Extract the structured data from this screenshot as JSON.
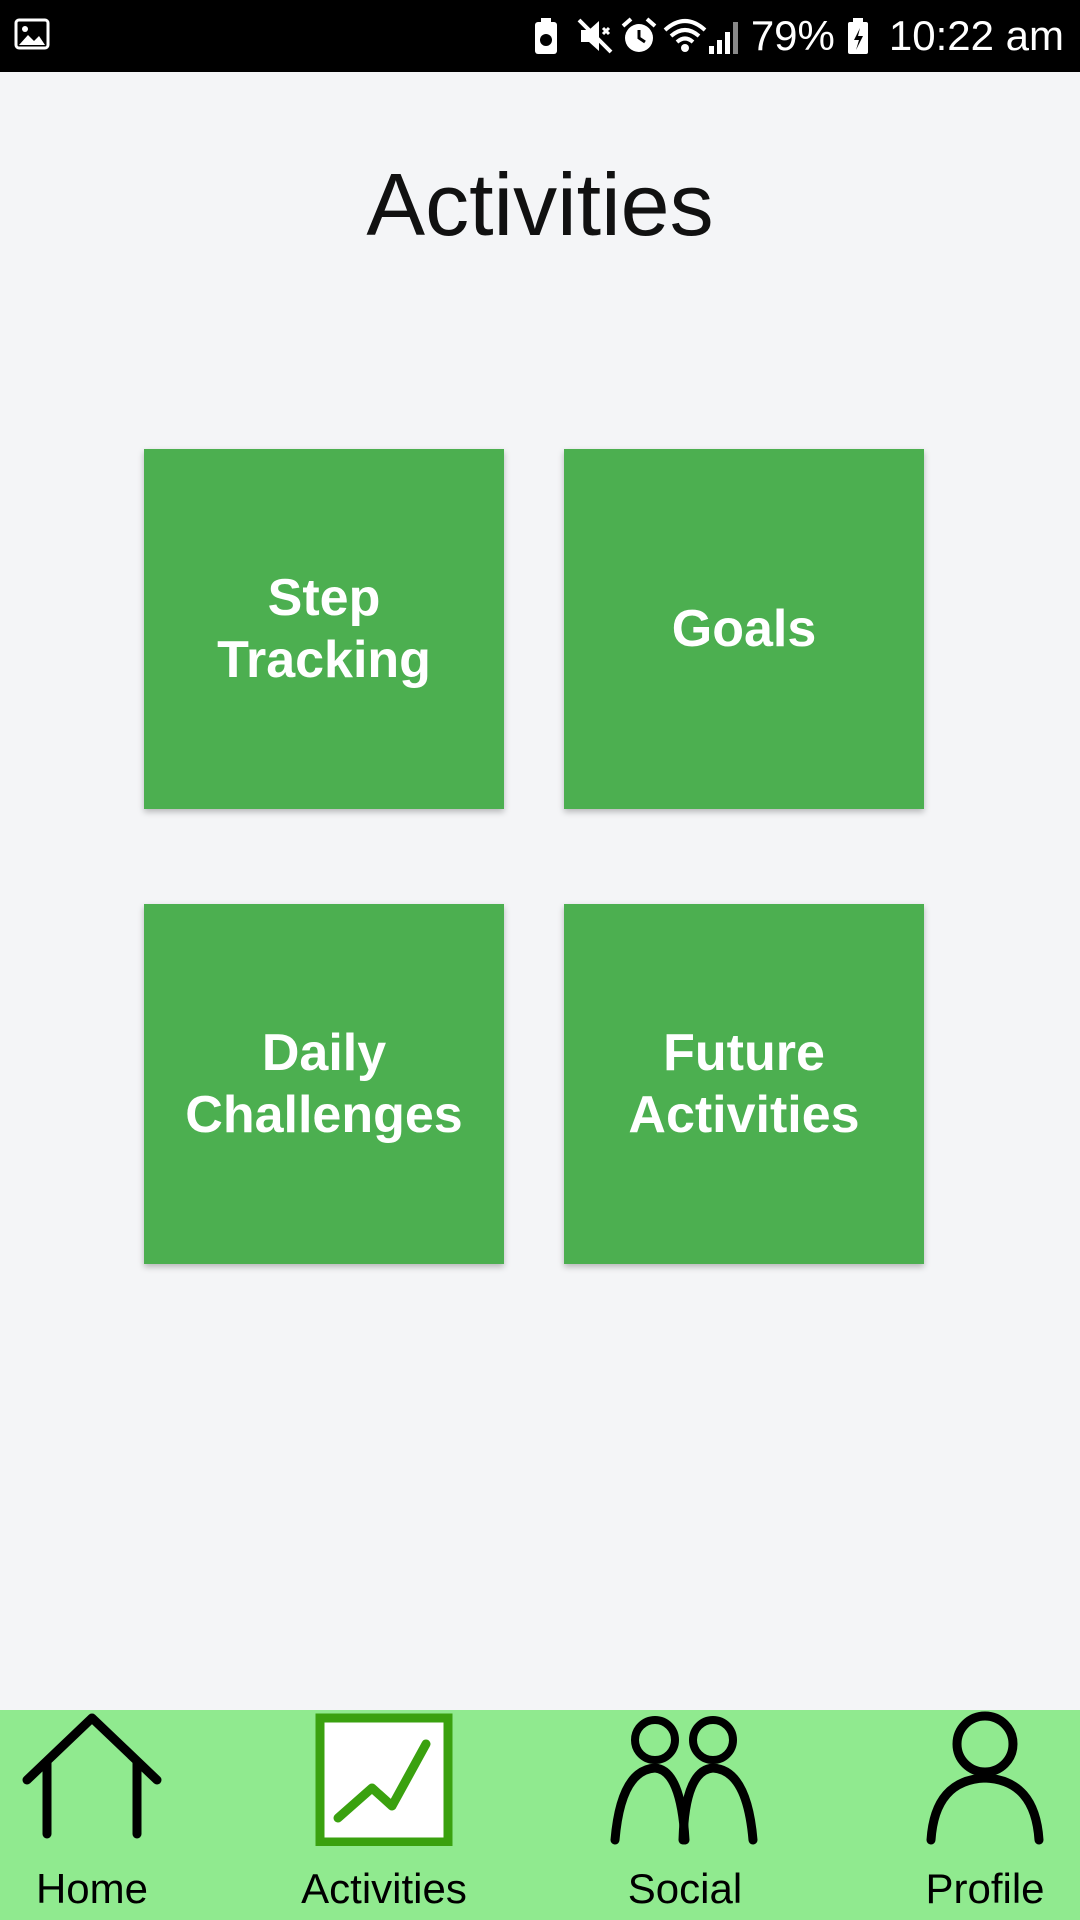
{
  "status_bar": {
    "battery_percent": "79%",
    "time": "10:22 am",
    "icons": [
      "image-icon",
      "battery-saver-icon",
      "mute-icon",
      "alarm-icon",
      "wifi-icon",
      "signal-icon",
      "battery-icon"
    ]
  },
  "page": {
    "title": "Activities"
  },
  "tiles": [
    {
      "line1": "Step Tracking",
      "line2": ""
    },
    {
      "line1": "Goals",
      "line2": ""
    },
    {
      "line1": "Daily",
      "line2": "Challenges"
    },
    {
      "line1": "Future",
      "line2": "Activities"
    }
  ],
  "bottom_nav": {
    "items": [
      {
        "label": "Home",
        "icon": "home-icon"
      },
      {
        "label": "Activities",
        "icon": "activities-chart-icon",
        "active": true
      },
      {
        "label": "Social",
        "icon": "social-people-icon"
      },
      {
        "label": "Profile",
        "icon": "profile-person-icon"
      }
    ]
  },
  "colors": {
    "tile_green": "#4caf50",
    "nav_bg": "#90ea8f",
    "active_icon": "#3aa10f",
    "page_bg": "#f4f5f7",
    "status_bg": "#000000"
  }
}
